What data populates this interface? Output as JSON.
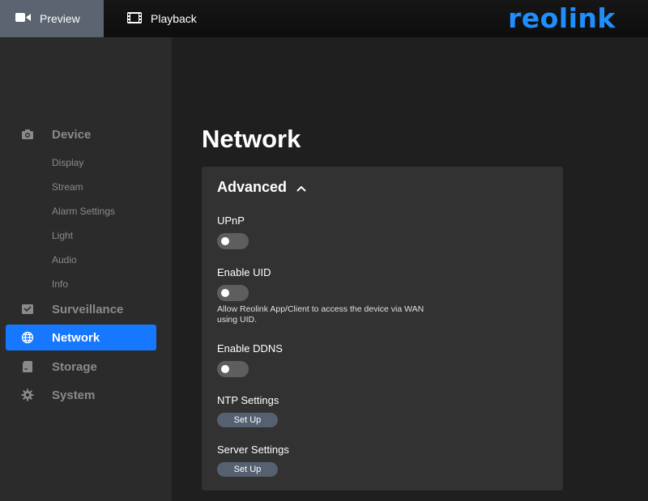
{
  "header": {
    "tabs": [
      {
        "label": "Preview",
        "icon": "video-camera-icon",
        "active": true
      },
      {
        "label": "Playback",
        "icon": "film-strip-icon",
        "active": false
      }
    ],
    "logo": "reolink",
    "accent": "#1677ff"
  },
  "sidebar": {
    "sections": [
      {
        "label": "Device",
        "icon": "camera-icon",
        "items": [
          "Display",
          "Stream",
          "Alarm Settings",
          "Light",
          "Audio",
          "Info"
        ]
      },
      {
        "label": "Surveillance",
        "icon": "monitor-icon"
      },
      {
        "label": "Network",
        "icon": "globe-icon",
        "active": true
      },
      {
        "label": "Storage",
        "icon": "sd-card-icon"
      },
      {
        "label": "System",
        "icon": "gear-icon"
      }
    ]
  },
  "main": {
    "title": "Network",
    "card": {
      "title": "Advanced",
      "upnp": {
        "label": "UPnP",
        "enabled": false
      },
      "uid": {
        "label": "Enable UID",
        "enabled": false,
        "description": "Allow Reolink App/Client to access the device via WAN using UID."
      },
      "ddns": {
        "label": "Enable DDNS",
        "enabled": false
      },
      "ntp": {
        "label": "NTP Settings",
        "button": "Set Up"
      },
      "server": {
        "label": "Server Settings",
        "button": "Set Up"
      }
    }
  }
}
